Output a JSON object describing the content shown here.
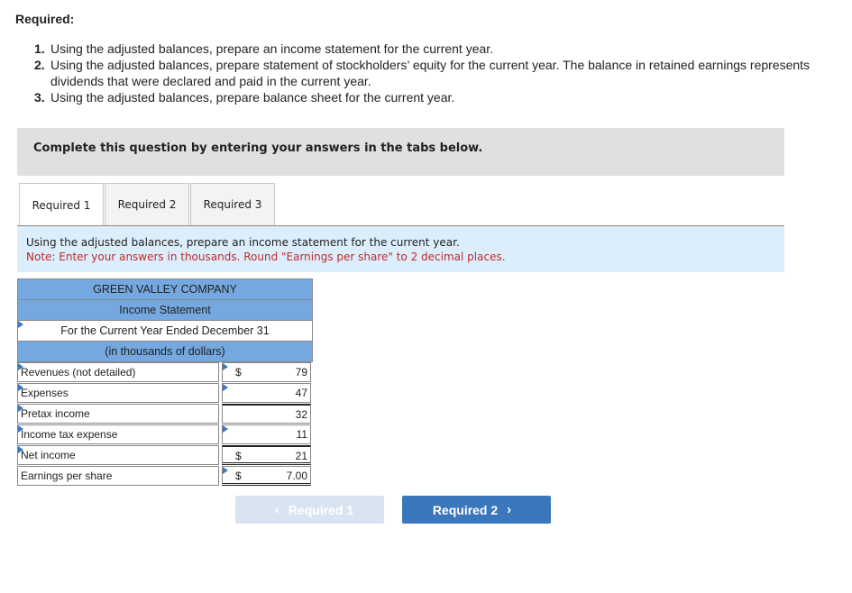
{
  "required": {
    "title": "Required:",
    "items": [
      {
        "num": "1.",
        "text": "Using the adjusted balances, prepare an income statement for the current year."
      },
      {
        "num": "2.",
        "text": "Using the adjusted balances, prepare statement of stockholders’ equity for the current year. The balance in retained earnings represents dividends that were declared and paid in the current year."
      },
      {
        "num": "3.",
        "text": "Using the adjusted balances, prepare balance sheet for the current year."
      }
    ]
  },
  "banner": "Complete this question by entering your answers in the tabs below.",
  "tabs": [
    {
      "label": "Required 1",
      "active": true
    },
    {
      "label": "Required 2",
      "active": false
    },
    {
      "label": "Required 3",
      "active": false
    }
  ],
  "instructions": {
    "line1": "Using the adjusted balances, prepare an income statement for the current year.",
    "note": "Note: Enter your answers in thousands. Round \"Earnings per share\" to 2 decimal places."
  },
  "statement": {
    "company": "GREEN VALLEY COMPANY",
    "title": "Income Statement",
    "period": "For the Current Year Ended December 31",
    "units": "(in thousands of dollars)",
    "rows": [
      {
        "label": "Revenues (not detailed)",
        "currency": "$",
        "value": "79"
      },
      {
        "label": "Expenses",
        "currency": "",
        "value": "47"
      },
      {
        "label": "Pretax income",
        "currency": "",
        "value": "32"
      },
      {
        "label": "Income tax expense",
        "currency": "",
        "value": "11"
      },
      {
        "label": "Net income",
        "currency": "$",
        "value": "21"
      },
      {
        "label": "Earnings per share",
        "currency": "$",
        "value": "7.00"
      }
    ]
  },
  "nav": {
    "prev_label": "Required 1",
    "next_label": "Required 2",
    "prev_icon": "‹",
    "next_icon": "›"
  },
  "colors": {
    "header_blue": "#75a8e0",
    "note_red": "#c0282d",
    "button_blue": "#3a77bc"
  }
}
